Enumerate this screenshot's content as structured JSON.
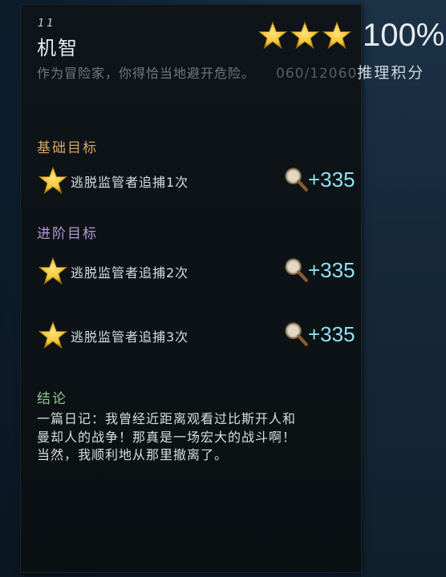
{
  "level": {
    "number": "11",
    "title": "机智",
    "subtitle": "作为冒险家，你得恰当地避开危险。",
    "star_count": 3,
    "completion_percent": "100%",
    "score_value": "060/12060",
    "score_label": "推理积分"
  },
  "sections": {
    "basic_heading": "基础目标",
    "advanced_heading": "进阶目标",
    "conclusion_heading": "结论"
  },
  "tasks": [
    {
      "label": "逃脱监管者追捕1次",
      "points": "+335",
      "icon": "gold-star-icon"
    },
    {
      "label": "逃脱监管者追捕2次",
      "points": "+335",
      "icon": "gold-star-icon"
    },
    {
      "label": "逃脱监管者追捕3次",
      "points": "+335",
      "icon": "gold-star-icon"
    }
  ],
  "conclusion": {
    "lines": [
      "一篇日记：我曾经近距离观看过比斯开人和",
      "曼却人的战争！那真是一场宏大的战斗啊！",
      "当然，我顺利地从那里撤离了。"
    ]
  },
  "colors": {
    "star_gold": "#f2c233",
    "points_cyan": "#8fe0f0",
    "basic_heading": "#d4a466",
    "advanced_heading": "#b39ad6",
    "conclusion_heading": "#8ec98e"
  }
}
